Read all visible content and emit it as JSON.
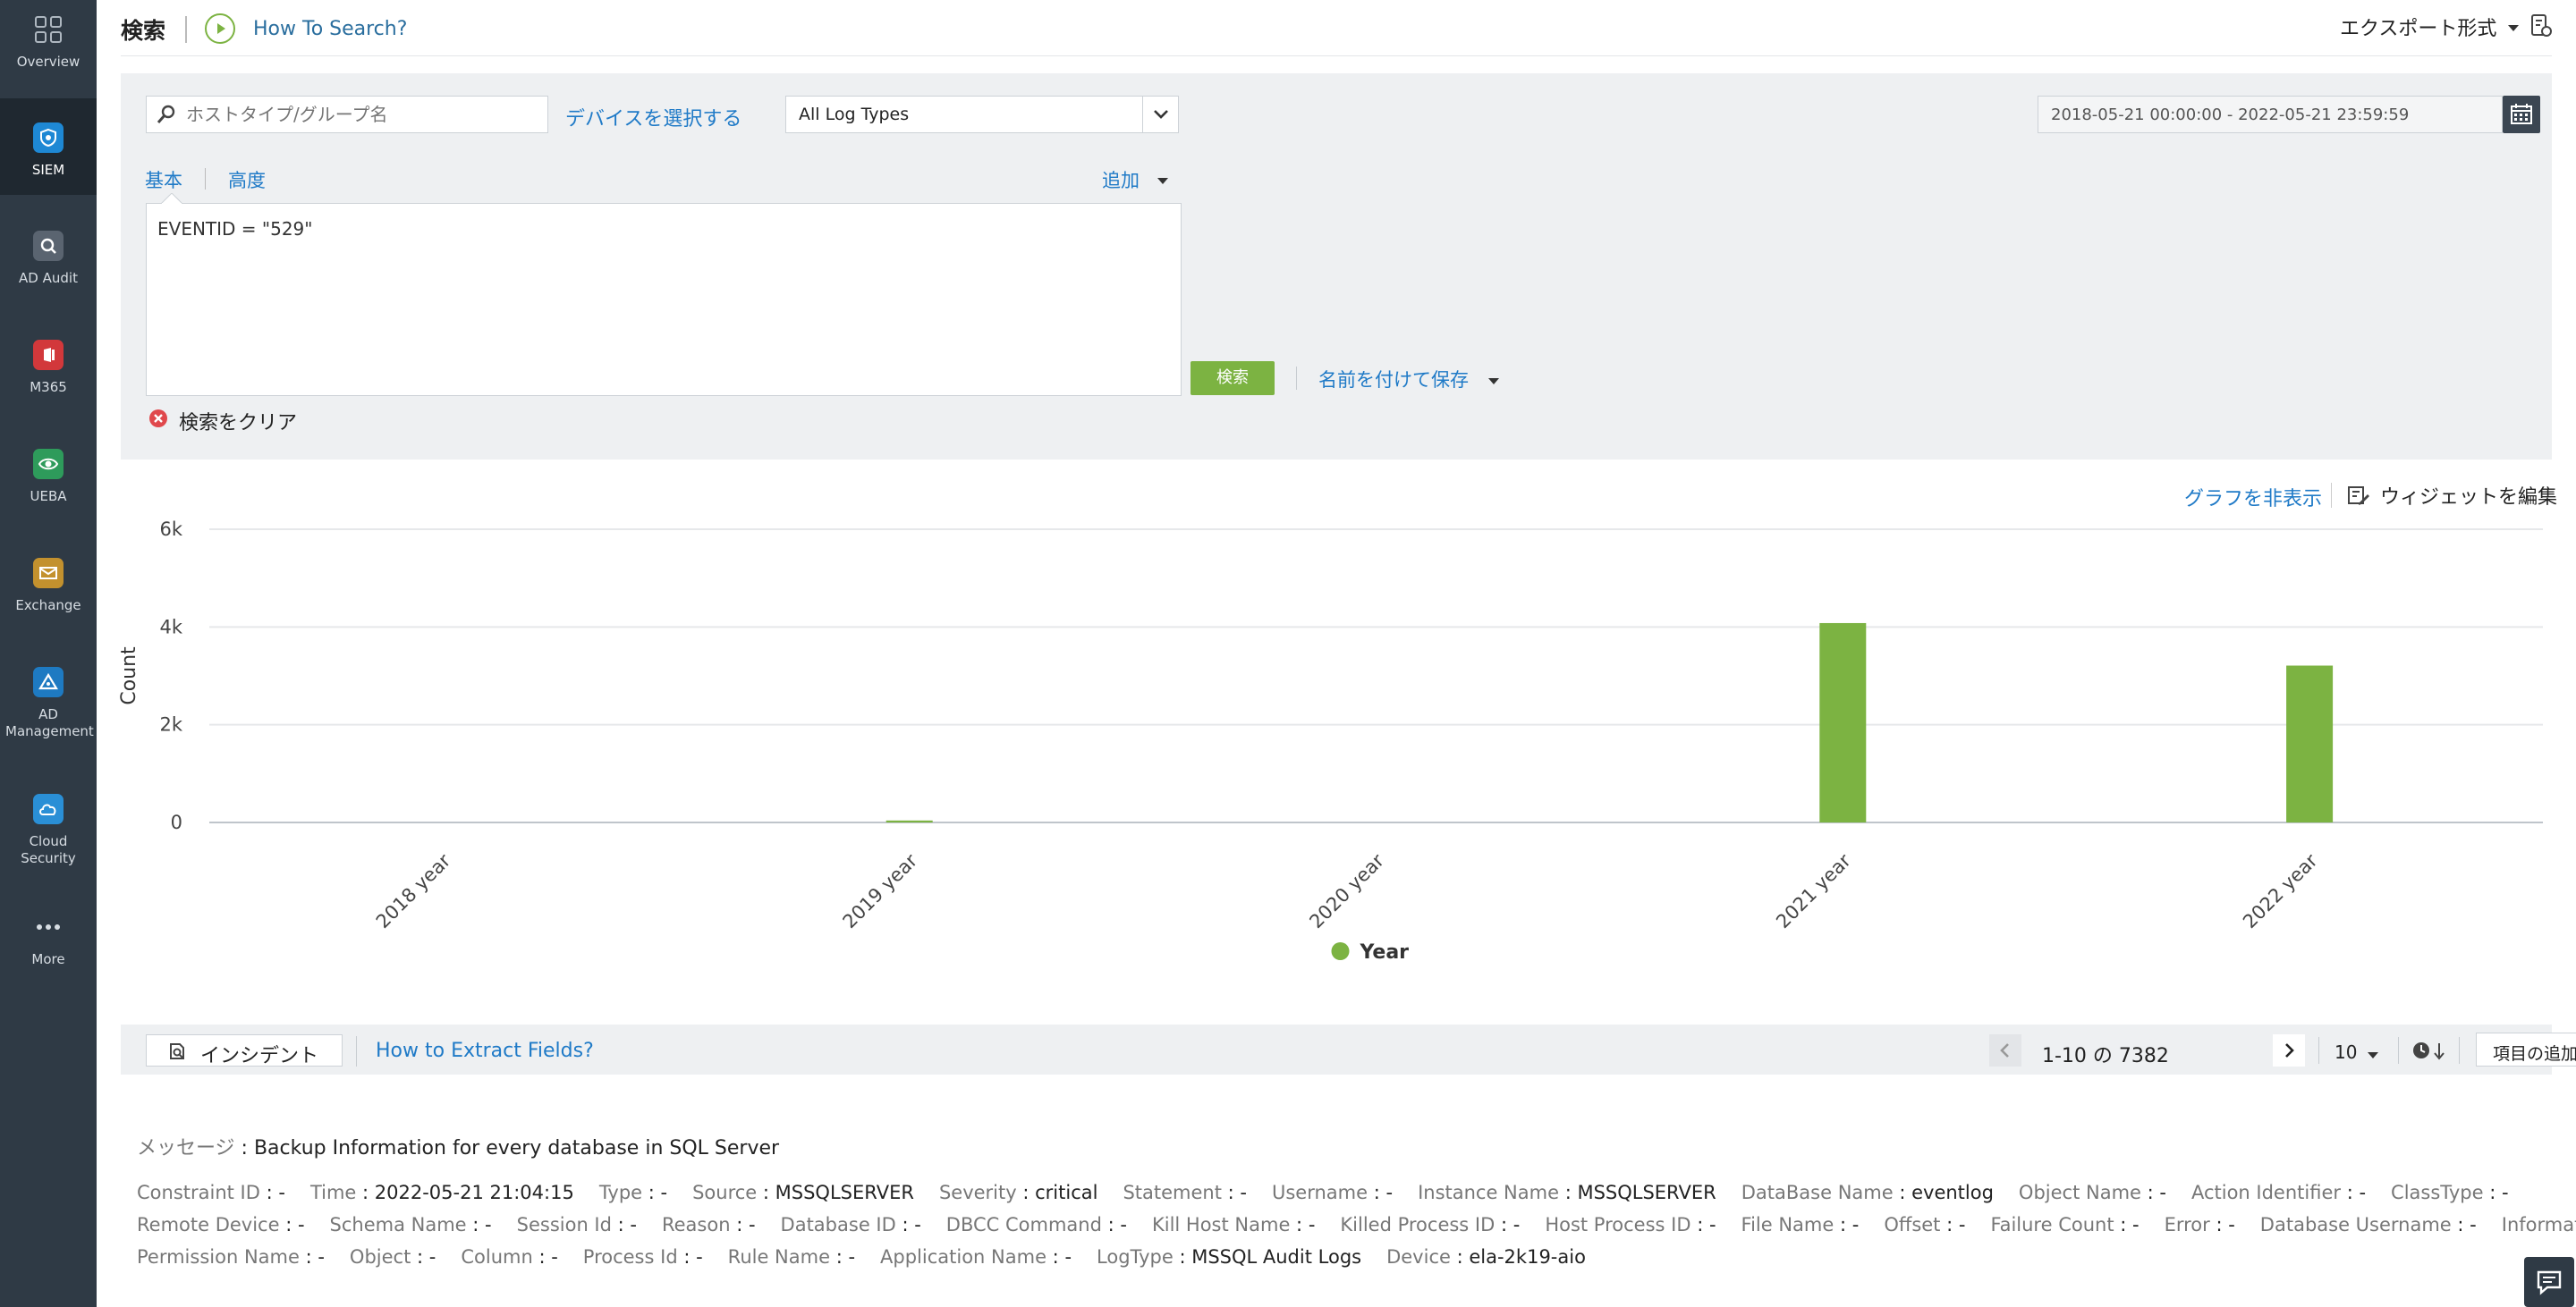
{
  "sidebar": {
    "items": [
      {
        "label": "Overview",
        "icon": "grid-icon"
      },
      {
        "label": "SIEM",
        "icon": "shield-icon"
      },
      {
        "label": "AD Audit",
        "icon": "magnifier-icon"
      },
      {
        "label": "M365",
        "icon": "office-icon"
      },
      {
        "label": "UEBA",
        "icon": "eye-icon"
      },
      {
        "label": "Exchange",
        "icon": "mail-icon"
      },
      {
        "label": "AD Management",
        "icon": "triangle-icon"
      },
      {
        "label": "Cloud Security",
        "icon": "cloud-icon"
      },
      {
        "label": "More",
        "icon": "ellipsis-icon"
      }
    ]
  },
  "header": {
    "title": "検索",
    "how_to": "How To Search?",
    "export": "エクスポート形式"
  },
  "search": {
    "host_placeholder": "ホストタイプ/グループ名",
    "select_device": "デバイスを選択する",
    "log_type": "All Log Types",
    "date_range": "2018-05-21 00:00:00 - 2022-05-21 23:59:59",
    "tab_basic": "基本",
    "tab_advanced": "高度",
    "add": "追加",
    "query": "EVENTID = \"529\"",
    "search_button": "検索",
    "save_as": "名前を付けて保存",
    "clear": "検索をクリア"
  },
  "chart_controls": {
    "hide_graph": "グラフを非表示",
    "edit_widget": "ウィジェットを編集"
  },
  "chart_data": {
    "type": "bar",
    "categories": [
      "2018 year",
      "2019 year",
      "2020 year",
      "2021 year",
      "2022 year"
    ],
    "series": [
      {
        "name": "Year",
        "values": [
          0,
          40,
          0,
          4080,
          3210
        ]
      }
    ],
    "ylabel": "Count",
    "ylim": [
      0,
      6000
    ],
    "yticks": [
      "0",
      "2k",
      "4k",
      "6k"
    ],
    "color": "#7cb342",
    "grid": true,
    "legend": "bottom"
  },
  "results_bar": {
    "incident": "インシデント",
    "extract_fields": "How to Extract Fields?",
    "pagination": "1-10 の 7382",
    "page_size": "10",
    "add_remove": "項目の追加/除外"
  },
  "record": {
    "message_key": "メッセージ",
    "message_value": "Backup Information for every database in SQL Server",
    "rows": [
      [
        {
          "k": "Constraint ID",
          "v": "-"
        },
        {
          "k": "Time",
          "v": "2022-05-21 21:04:15"
        },
        {
          "k": "Type",
          "v": "-"
        },
        {
          "k": "Source",
          "v": "MSSQLSERVER"
        },
        {
          "k": "Severity",
          "v": "critical"
        },
        {
          "k": "Statement",
          "v": "-"
        },
        {
          "k": "Username",
          "v": "-"
        },
        {
          "k": "Instance Name",
          "v": "MSSQLSERVER"
        },
        {
          "k": "DataBase Name",
          "v": "eventlog"
        },
        {
          "k": "Object Name",
          "v": "-"
        },
        {
          "k": "Action Identifier",
          "v": "-"
        },
        {
          "k": "ClassType",
          "v": "-"
        }
      ],
      [
        {
          "k": "Remote Device",
          "v": "-"
        },
        {
          "k": "Schema Name",
          "v": "-"
        },
        {
          "k": "Session Id",
          "v": "-"
        },
        {
          "k": "Reason",
          "v": "-"
        },
        {
          "k": "Database ID",
          "v": "-"
        },
        {
          "k": "DBCC Command",
          "v": "-"
        },
        {
          "k": "Kill Host Name",
          "v": "-"
        },
        {
          "k": "Killed Process ID",
          "v": "-"
        },
        {
          "k": "Host Process ID",
          "v": "-"
        },
        {
          "k": "File Name",
          "v": "-"
        },
        {
          "k": "Offset",
          "v": "-"
        },
        {
          "k": "Failure Count",
          "v": "-"
        },
        {
          "k": "Error",
          "v": "-"
        },
        {
          "k": "Database Username",
          "v": "-"
        },
        {
          "k": "Information",
          "v": "-"
        }
      ],
      [
        {
          "k": "Permission Name",
          "v": "-"
        },
        {
          "k": "Object",
          "v": "-"
        },
        {
          "k": "Column",
          "v": "-"
        },
        {
          "k": "Process Id",
          "v": "-"
        },
        {
          "k": "Rule Name",
          "v": "-"
        },
        {
          "k": "Application Name",
          "v": "-"
        },
        {
          "k": "LogType",
          "v": "MSSQL Audit Logs"
        },
        {
          "k": "Device",
          "v": "ela-2k19-aio"
        }
      ]
    ]
  }
}
